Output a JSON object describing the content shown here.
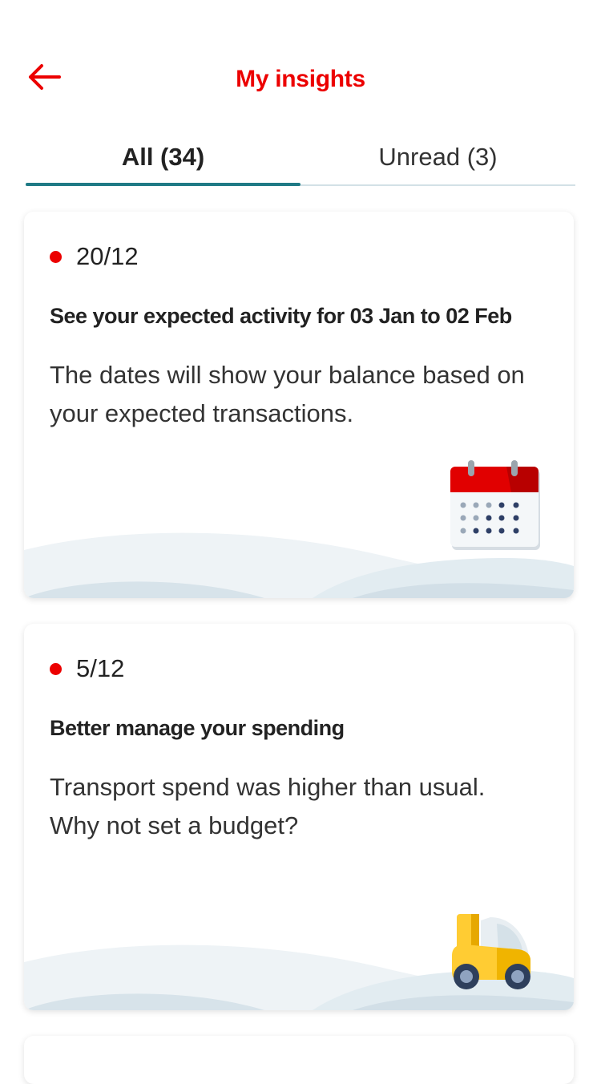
{
  "header": {
    "back_icon": "arrow-left-icon",
    "title": "My insights",
    "accent_color": "#ec0000"
  },
  "tabs": [
    {
      "label": "All (34)",
      "active": true
    },
    {
      "label": "Unread (3)",
      "active": false
    }
  ],
  "insights": [
    {
      "date": "20/12",
      "unread": true,
      "title": "See your expected activity for 03 Jan to 02 Feb",
      "description": "The dates will show your balance based on your expected transactions.",
      "icon": "calendar-icon"
    },
    {
      "date": "5/12",
      "unread": true,
      "title": "Better manage your spending",
      "description": "Transport spend was higher than usual. Why not set a budget?",
      "icon": "car-icon"
    }
  ]
}
